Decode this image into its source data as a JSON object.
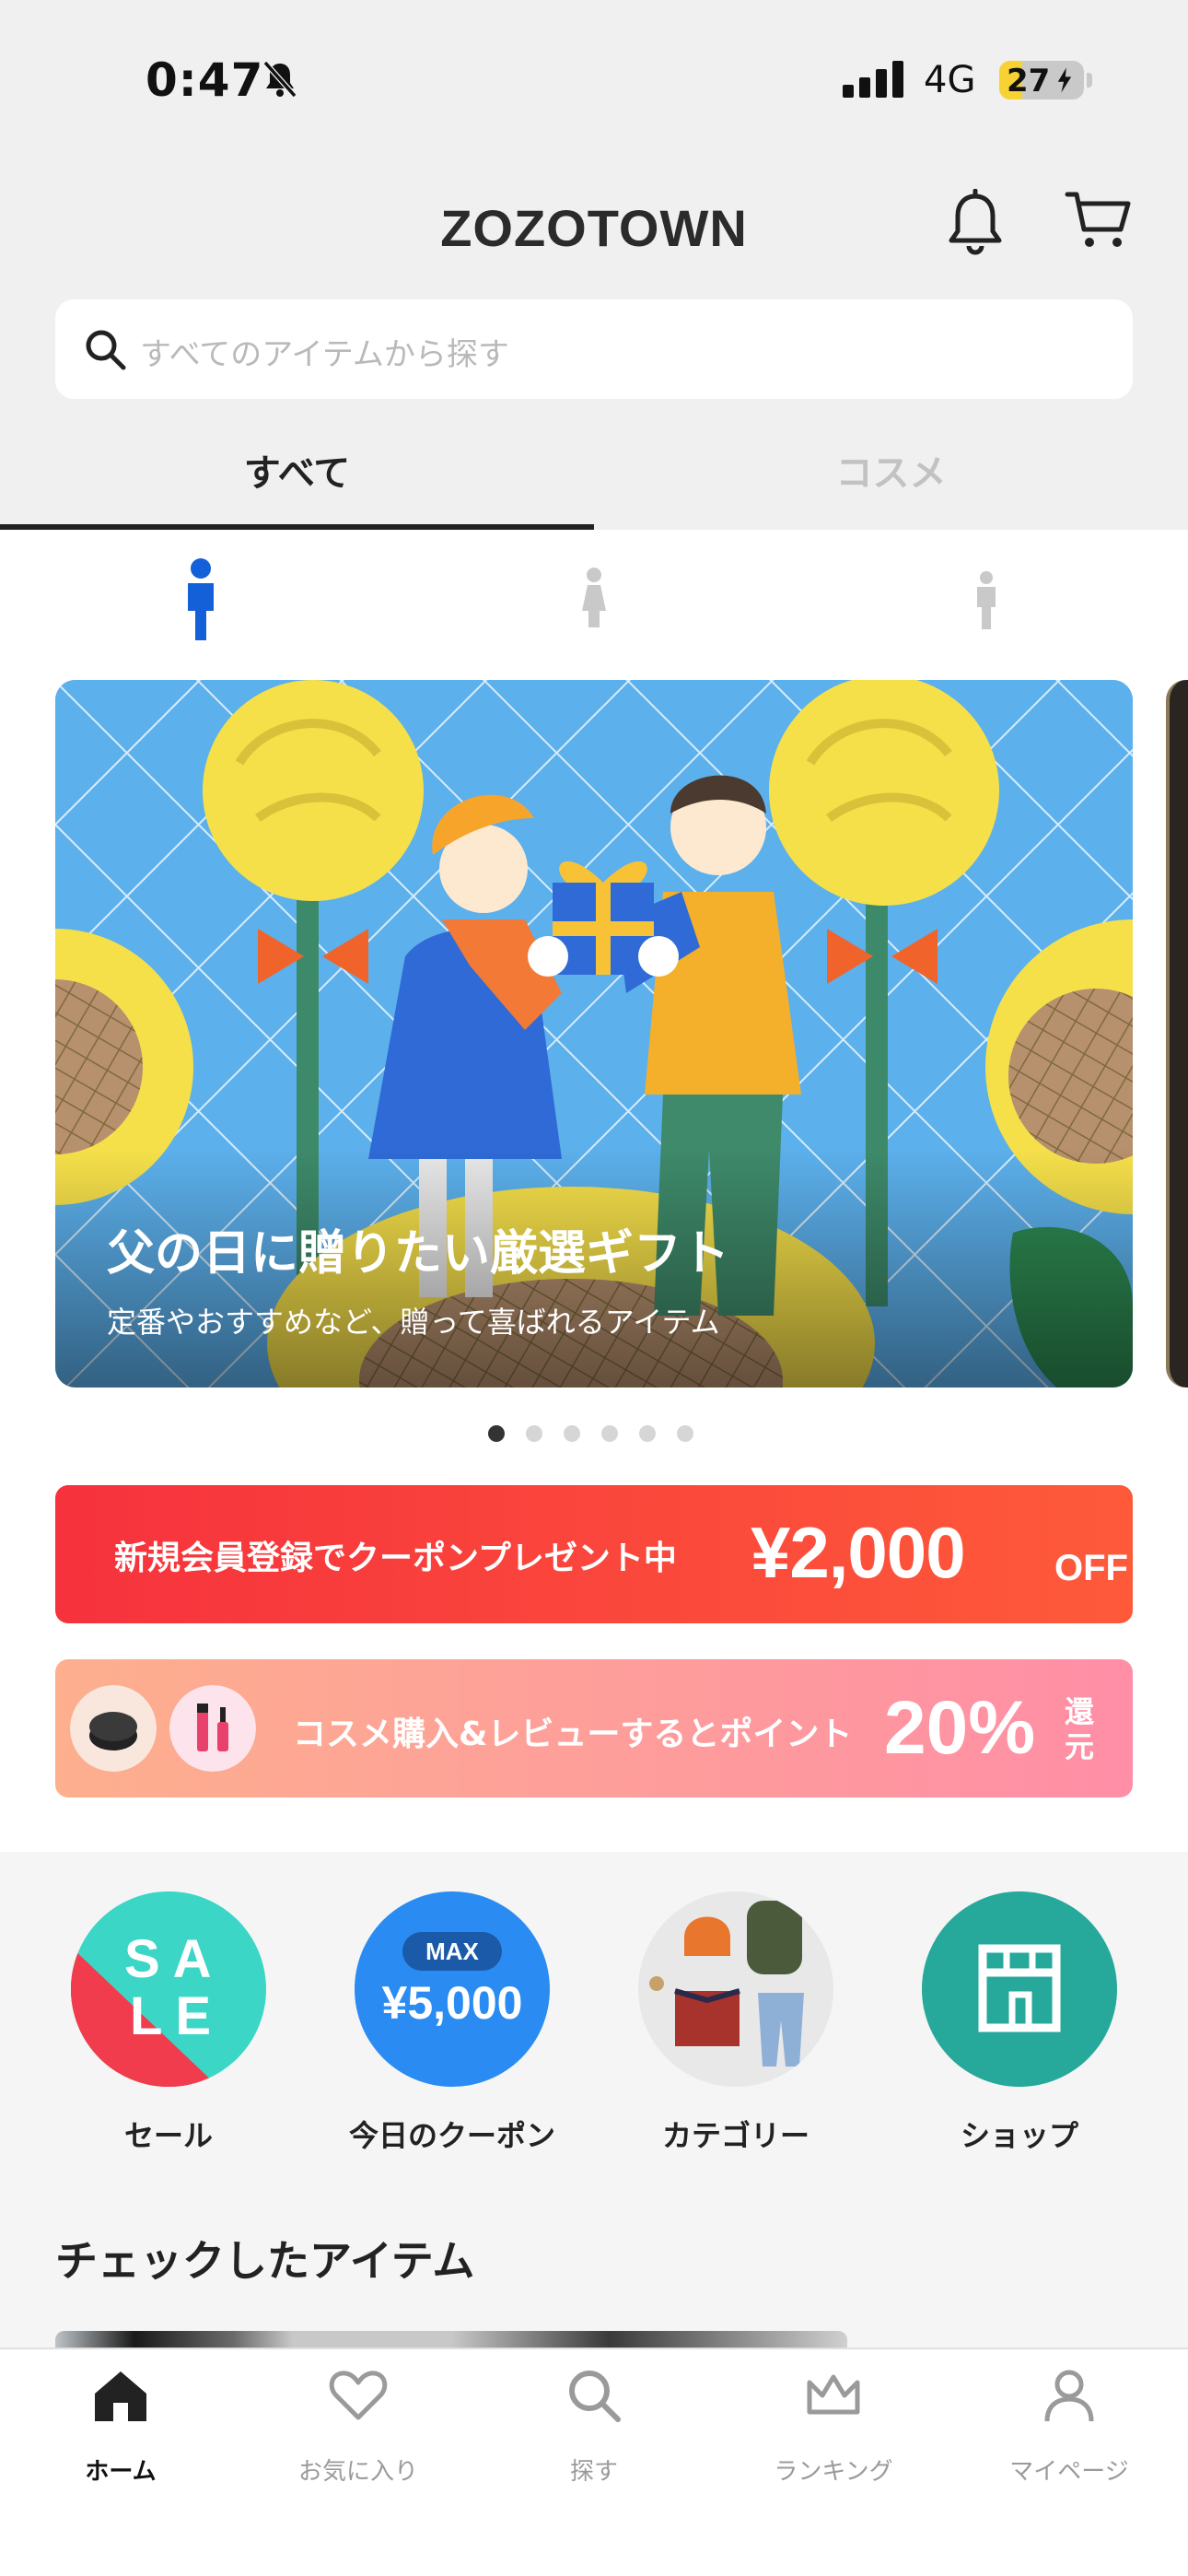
{
  "status_bar": {
    "time": "0:47",
    "network": "4G",
    "battery_level": "27",
    "battery_fraction": 0.27
  },
  "header": {
    "app_title": "ZOZOTOWN"
  },
  "search": {
    "placeholder": "すべてのアイテムから探す"
  },
  "tabs": [
    {
      "label": "すべて",
      "active": true
    },
    {
      "label": "コスメ",
      "active": false
    }
  ],
  "gender_filter": {
    "options": [
      "men-icon",
      "women-icon",
      "kids-icon"
    ],
    "selected": "men-icon",
    "accent": "#1460d8"
  },
  "carousel": {
    "title": "父の日に贈りたい厳選ギフト",
    "subtitle": "定番やおすすめなど、贈って喜ばれるアイテム",
    "slide_count": 6,
    "active_index": 0
  },
  "promos": {
    "coupon": {
      "text": "新規会員登録でクーポンプレゼント中",
      "amount": "¥2,000",
      "suffix": "OFF",
      "color": "#f6323d"
    },
    "cosme": {
      "text": "コスメ購入&レビューするとポイント",
      "percent": "20%",
      "suffix": "還元",
      "color": "#ff8ea6"
    }
  },
  "quick_links": [
    {
      "label": "セール",
      "badge_text": "SALE"
    },
    {
      "label": "今日のクーポン",
      "badge_top": "MAX",
      "badge_amount": "¥5,000"
    },
    {
      "label": "カテゴリー"
    },
    {
      "label": "ショップ"
    }
  ],
  "checked_items": {
    "title": "チェックしたアイテム"
  },
  "bottom_nav": [
    {
      "label": "ホーム",
      "icon": "home-icon",
      "active": true
    },
    {
      "label": "お気に入り",
      "icon": "heart-icon",
      "active": false
    },
    {
      "label": "探す",
      "icon": "search-icon",
      "active": false
    },
    {
      "label": "ランキング",
      "icon": "crown-icon",
      "active": false
    },
    {
      "label": "マイページ",
      "icon": "person-icon",
      "active": false
    }
  ]
}
